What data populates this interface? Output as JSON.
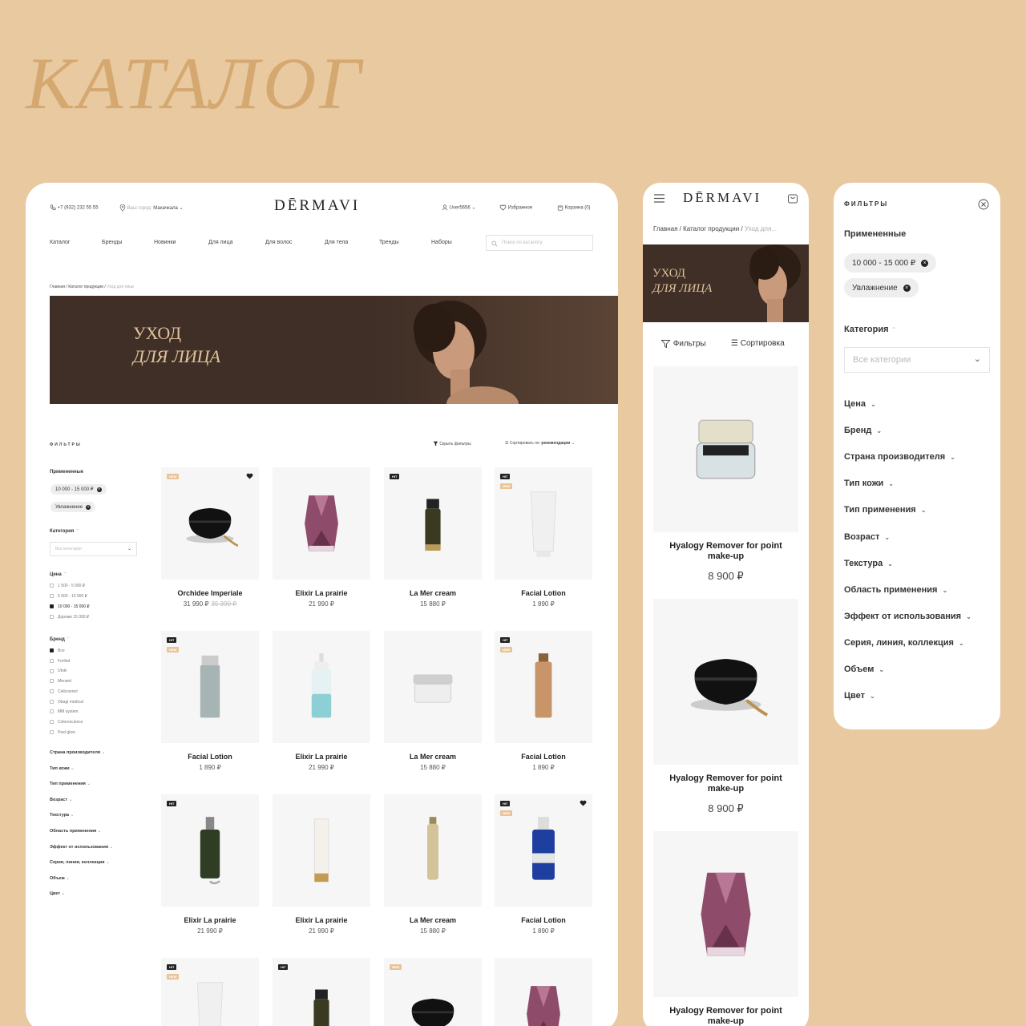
{
  "hero": {
    "title": "КАТАЛОГ"
  },
  "desktop": {
    "phone": "+7 (932) 232 55 55",
    "city_label": "Ваш город:",
    "city": "Махачкала",
    "logo": "DĒRMAVI",
    "user": "User5656",
    "favorites": "Избранное",
    "cart": "Корзина (0)",
    "nav": [
      "Каталог",
      "Бренды",
      "Новинки",
      "Для лица",
      "Для волос",
      "Для тела",
      "Тренды",
      "Наборы"
    ],
    "search_placeholder": "Поиск по каталогу",
    "breadcrumb": [
      "Главная",
      "Каталог продукции",
      "Уход для лица"
    ],
    "banner": {
      "line1": "УХОД",
      "line2": "ДЛЯ ЛИЦА"
    },
    "filters_title": "ФИЛЬТРЫ",
    "hide_filters": "Скрыть фильтры",
    "sort_label": "Сортировать по:",
    "sort_value": "рекомендации",
    "applied_label": "Примененные",
    "applied": [
      "10 000 - 15 000 ₽",
      "Увлажнение"
    ],
    "category_label": "Категория",
    "category_placeholder": "Все категории",
    "price_label": "Цена",
    "price_options": [
      {
        "label": "1 500 - 5 000 ₽",
        "checked": false
      },
      {
        "label": "5 000 - 10 000 ₽",
        "checked": false
      },
      {
        "label": "10 000 - 15 000 ₽",
        "checked": true
      },
      {
        "label": "Дороже 15 000 ₽",
        "checked": false
      }
    ],
    "brand_label": "Бренд",
    "brand_options": [
      {
        "label": "Все",
        "checked": true
      },
      {
        "label": "Forlled",
        "checked": false
      },
      {
        "label": "Utoki",
        "checked": false
      },
      {
        "label": "Menard",
        "checked": false
      },
      {
        "label": "Cellcosmet",
        "checked": false
      },
      {
        "label": "Obagi medical",
        "checked": false
      },
      {
        "label": "MM system",
        "checked": false
      },
      {
        "label": "Colorescience",
        "checked": false
      },
      {
        "label": "Peel glow",
        "checked": false
      }
    ],
    "more_filters": [
      "Страна производителя",
      "Тип кожи",
      "Тип применения",
      "Возраст",
      "Текстура",
      "Область применения",
      "Эффект от использования",
      "Серия, линия, коллекция",
      "Объем",
      "Цвет"
    ],
    "products": [
      {
        "name": "Orchidee Imperiale",
        "price": "31 990 ₽",
        "old_price": "35 390 ₽",
        "badges": [
          "NEW"
        ],
        "fav": true,
        "img": "black-jar"
      },
      {
        "name": "Elixir La prairie",
        "price": "21 990 ₽",
        "old_price": "",
        "badges": [],
        "fav": false,
        "img": "purple-bottle"
      },
      {
        "name": "La Mer cream",
        "price": "15 880 ₽",
        "old_price": "",
        "badges": [
          "HIT"
        ],
        "fav": false,
        "img": "dark-bottle"
      },
      {
        "name": "Facial Lotion",
        "price": "1 890 ₽",
        "old_price": "",
        "badges": [
          "HIT",
          "NEW"
        ],
        "fav": false,
        "img": "white-tube"
      },
      {
        "name": "Facial Lotion",
        "price": "1 890 ₽",
        "old_price": "",
        "badges": [
          "HIT",
          "NEW"
        ],
        "fav": false,
        "img": "frost-bottle"
      },
      {
        "name": "Elixir La prairie",
        "price": "21 990 ₽",
        "old_price": "",
        "badges": [],
        "fav": false,
        "img": "pump-bottle"
      },
      {
        "name": "La Mer cream",
        "price": "15 880 ₽",
        "old_price": "",
        "badges": [],
        "fav": false,
        "img": "silver-jar"
      },
      {
        "name": "Facial Lotion",
        "price": "1 890 ₽",
        "old_price": "",
        "badges": [
          "HIT",
          "NEW"
        ],
        "fav": false,
        "img": "gold-bottle"
      },
      {
        "name": "Elixir La prairie",
        "price": "21 990 ₽",
        "old_price": "",
        "badges": [
          "HIT"
        ],
        "fav": false,
        "img": "green-dropper"
      },
      {
        "name": "Elixir La prairie",
        "price": "21 990 ₽",
        "old_price": "",
        "badges": [],
        "fav": false,
        "img": "white-tube-gold"
      },
      {
        "name": "La Mer cream",
        "price": "15 880 ₽",
        "old_price": "",
        "badges": [],
        "fav": false,
        "img": "gold-pen"
      },
      {
        "name": "Facial Lotion",
        "price": "1 890 ₽",
        "old_price": "",
        "badges": [
          "HIT",
          "NEW"
        ],
        "fav": true,
        "img": "blue-dropper"
      },
      {
        "name": "",
        "price": "",
        "old_price": "",
        "badges": [
          "HIT",
          "NEW"
        ],
        "fav": false,
        "img": "white-tube"
      },
      {
        "name": "",
        "price": "",
        "old_price": "",
        "badges": [
          "HIT"
        ],
        "fav": false,
        "img": "dark-bottle"
      },
      {
        "name": "",
        "price": "",
        "old_price": "",
        "badges": [
          "NEW"
        ],
        "fav": false,
        "img": "black-jar"
      },
      {
        "name": "",
        "price": "",
        "old_price": "",
        "badges": [],
        "fav": false,
        "img": "purple-bottle"
      }
    ]
  },
  "mobile": {
    "logo": "DĒRMAVI",
    "breadcrumb": [
      "Главная",
      "Каталог продукции",
      "Уход для..."
    ],
    "banner": {
      "line1": "УХОД",
      "line2": "ДЛЯ ЛИЦА"
    },
    "filters_btn": "Фильтры",
    "sort_btn": "Сортировка",
    "products": [
      {
        "name": "Hyalogy Remover for point make-up",
        "price": "8 900 ₽",
        "img": "sensai-jar"
      },
      {
        "name": "Hyalogy Remover for point make-up",
        "price": "8 900 ₽",
        "img": "black-jar"
      },
      {
        "name": "Hyalogy Remover for point make-up",
        "price": "",
        "img": "purple-bottle"
      }
    ]
  },
  "filters_panel": {
    "title": "ФИЛЬТРЫ",
    "applied_label": "Примененные",
    "applied": [
      "10 000 - 15 000 ₽",
      "Увлажнение"
    ],
    "category_label": "Категория",
    "category_placeholder": "Все категории",
    "items": [
      "Цена",
      "Бренд",
      "Страна производителя",
      "Тип кожи",
      "Тип применения",
      "Возраст",
      "Текстура",
      "Область применения",
      "Эффект от использования",
      "Серия, линия, коллекция",
      "Объем",
      "Цвет"
    ]
  }
}
